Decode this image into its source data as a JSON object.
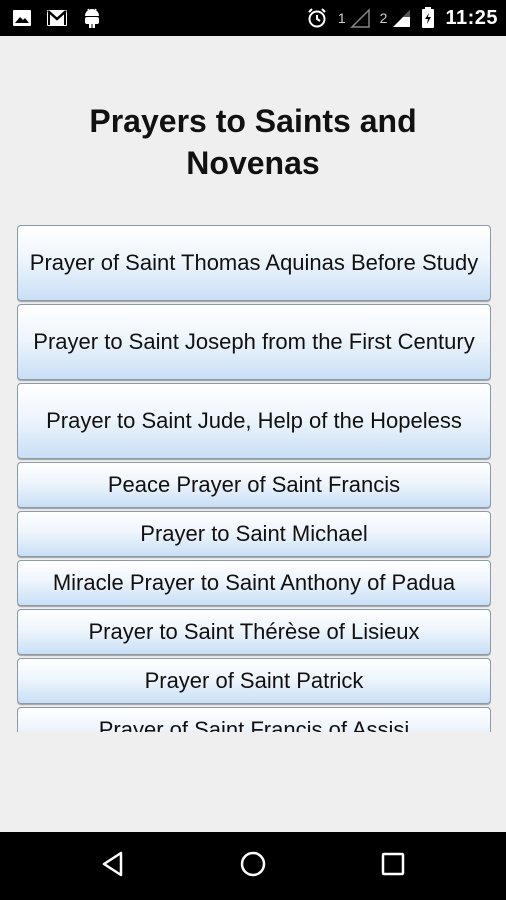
{
  "status_bar": {
    "left_icons": [
      "image-icon",
      "gmail-icon",
      "android-icon"
    ],
    "sim1_label": "1",
    "sim2_label": "2",
    "time": "11:25"
  },
  "page": {
    "title": "Prayers to Saints and Novenas"
  },
  "prayers": [
    {
      "label": "Prayer of Saint Thomas Aquinas Before Study"
    },
    {
      "label": "Prayer to Saint Joseph from the First Century"
    },
    {
      "label": "Prayer to Saint Jude, Help of the Hopeless"
    },
    {
      "label": "Peace Prayer of Saint Francis"
    },
    {
      "label": "Prayer to Saint Michael"
    },
    {
      "label": "Miracle Prayer to Saint Anthony of Padua"
    },
    {
      "label": "Prayer to Saint Thérèse of Lisieux"
    },
    {
      "label": "Prayer of Saint Patrick"
    },
    {
      "label": "Prayer of Saint Francis of Assisi"
    }
  ],
  "nav_bar": {
    "icons": [
      "back-icon",
      "home-icon",
      "recents-icon"
    ]
  }
}
